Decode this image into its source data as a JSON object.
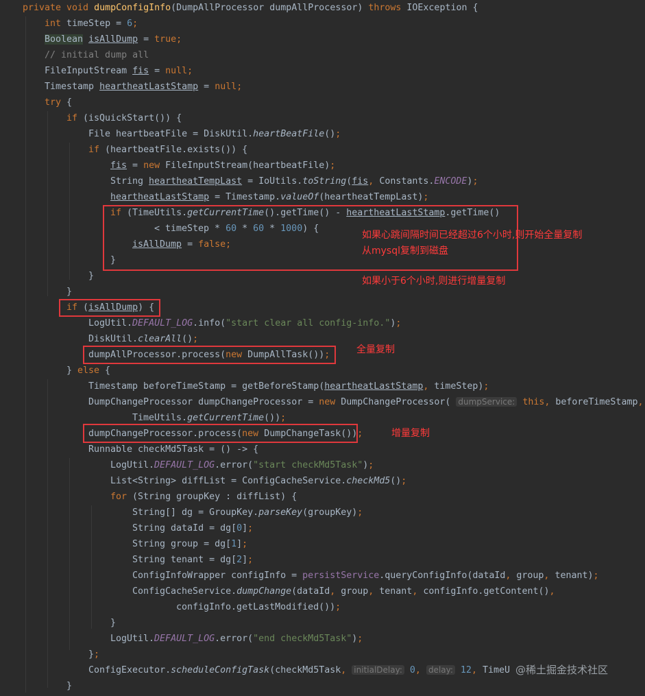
{
  "code_lines": [
    [
      {
        "c": "kw",
        "t": "private void "
      },
      {
        "c": "fn",
        "t": "dumpConfigInfo"
      },
      {
        "c": "",
        "t": "(DumpAllProcessor dumpAllProcessor) "
      },
      {
        "c": "kw",
        "t": "throws "
      },
      {
        "c": "",
        "t": "IOException {"
      }
    ],
    [
      {
        "c": "kw",
        "t": "int "
      },
      {
        "c": "",
        "t": "timeStep = "
      },
      {
        "c": "num",
        "t": "6"
      },
      {
        "c": "kw",
        "t": ";"
      }
    ],
    [
      {
        "c": "hlword",
        "t": "Boolean"
      },
      {
        "c": "",
        "t": " "
      },
      {
        "c": "ul",
        "t": "isAllDump"
      },
      {
        "c": "",
        "t": " = "
      },
      {
        "c": "kw",
        "t": "true;"
      }
    ],
    [
      {
        "c": "cmt",
        "t": "// initial dump all"
      }
    ],
    [
      {
        "c": "",
        "t": "FileInputStream "
      },
      {
        "c": "ul",
        "t": "fis"
      },
      {
        "c": "",
        "t": " = "
      },
      {
        "c": "kw",
        "t": "null;"
      }
    ],
    [
      {
        "c": "",
        "t": "Timestamp "
      },
      {
        "c": "ul",
        "t": "heartheatLastStamp"
      },
      {
        "c": "",
        "t": " = "
      },
      {
        "c": "kw",
        "t": "null;"
      }
    ],
    [
      {
        "c": "kw",
        "t": "try "
      },
      {
        "c": "",
        "t": "{"
      }
    ],
    [
      {
        "c": "kw",
        "t": "if "
      },
      {
        "c": "",
        "t": "(isQuickStart()) {"
      }
    ],
    [
      {
        "c": "",
        "t": "File heartbeatFile = DiskUtil."
      },
      {
        "c": "it",
        "t": "heartBeatFile"
      },
      {
        "c": "",
        "t": "()"
      },
      {
        "c": "kw",
        "t": ";"
      }
    ],
    [
      {
        "c": "kw",
        "t": "if "
      },
      {
        "c": "",
        "t": "(heartbeatFile.exists()) {"
      }
    ],
    [
      {
        "c": "ul",
        "t": "fis"
      },
      {
        "c": "",
        "t": " = "
      },
      {
        "c": "kw",
        "t": "new "
      },
      {
        "c": "",
        "t": "FileInputStream(heartbeatFile)"
      },
      {
        "c": "kw",
        "t": ";"
      }
    ],
    [
      {
        "c": "",
        "t": "String "
      },
      {
        "c": "ul",
        "t": "heartheatTempLast"
      },
      {
        "c": "",
        "t": " = IoUtils."
      },
      {
        "c": "it",
        "t": "toString"
      },
      {
        "c": "",
        "t": "("
      },
      {
        "c": "ul",
        "t": "fis"
      },
      {
        "c": "kw",
        "t": ", "
      },
      {
        "c": "",
        "t": "Constants."
      },
      {
        "c": "fld",
        "t": "ENCODE"
      },
      {
        "c": "",
        "t": ")"
      },
      {
        "c": "kw",
        "t": ";"
      }
    ],
    [
      {
        "c": "ul",
        "t": "heartheatLastStamp"
      },
      {
        "c": "",
        "t": " = Timestamp."
      },
      {
        "c": "it",
        "t": "valueOf"
      },
      {
        "c": "",
        "t": "(heartheatTempLast)"
      },
      {
        "c": "kw",
        "t": ";"
      }
    ],
    [
      {
        "c": "kw",
        "t": "if "
      },
      {
        "c": "",
        "t": "(TimeUtils."
      },
      {
        "c": "it",
        "t": "getCurrentTime"
      },
      {
        "c": "",
        "t": "().getTime() - "
      },
      {
        "c": "ul",
        "t": "heartheatLastStamp"
      },
      {
        "c": "",
        "t": ".getTime()"
      }
    ],
    [
      {
        "c": "",
        "t": "< timeStep * "
      },
      {
        "c": "num",
        "t": "60"
      },
      {
        "c": "",
        "t": " * "
      },
      {
        "c": "num",
        "t": "60"
      },
      {
        "c": "",
        "t": " * "
      },
      {
        "c": "num",
        "t": "1000"
      },
      {
        "c": "",
        "t": ") {"
      }
    ],
    [
      {
        "c": "ul",
        "t": "isAllDump"
      },
      {
        "c": "",
        "t": " = "
      },
      {
        "c": "kw",
        "t": "false;"
      }
    ],
    [
      {
        "c": "",
        "t": "}"
      }
    ],
    [
      {
        "c": "",
        "t": "}"
      }
    ],
    [
      {
        "c": "",
        "t": "}"
      }
    ],
    [
      {
        "c": "kw",
        "t": "if "
      },
      {
        "c": "",
        "t": "("
      },
      {
        "c": "ul",
        "t": "isAllDump"
      },
      {
        "c": "",
        "t": ") {"
      }
    ],
    [
      {
        "c": "",
        "t": "LogUtil."
      },
      {
        "c": "fld",
        "t": "DEFAULT_LOG"
      },
      {
        "c": "",
        "t": ".info("
      },
      {
        "c": "str",
        "t": "\"start clear all config-info.\""
      },
      {
        "c": "",
        "t": ")"
      },
      {
        "c": "kw",
        "t": ";"
      }
    ],
    [
      {
        "c": "",
        "t": "DiskUtil."
      },
      {
        "c": "it",
        "t": "clearAll"
      },
      {
        "c": "",
        "t": "()"
      },
      {
        "c": "kw",
        "t": ";"
      }
    ],
    [
      {
        "c": "",
        "t": "dumpAllProcessor.process("
      },
      {
        "c": "kw",
        "t": "new "
      },
      {
        "c": "",
        "t": "DumpAllTask())"
      },
      {
        "c": "kw",
        "t": ";"
      }
    ],
    [
      {
        "c": "",
        "t": "} "
      },
      {
        "c": "kw",
        "t": "else "
      },
      {
        "c": "",
        "t": "{"
      }
    ],
    [
      {
        "c": "",
        "t": "Timestamp beforeTimeStamp = getBeforeStamp("
      },
      {
        "c": "ul",
        "t": "heartheatLastStamp"
      },
      {
        "c": "kw",
        "t": ", "
      },
      {
        "c": "",
        "t": "timeStep)"
      },
      {
        "c": "kw",
        "t": ";"
      }
    ],
    [
      {
        "c": "",
        "t": "DumpChangeProcessor dumpChangeProcessor = "
      },
      {
        "c": "kw",
        "t": "new "
      },
      {
        "c": "",
        "t": "DumpChangeProcessor( "
      },
      {
        "c": "hint",
        "t": "dumpService:"
      },
      {
        "c": "",
        "t": " "
      },
      {
        "c": "kw",
        "t": "this, "
      },
      {
        "c": "",
        "t": "beforeTimeStamp"
      },
      {
        "c": "kw",
        "t": ","
      }
    ],
    [
      {
        "c": "",
        "t": "TimeUtils."
      },
      {
        "c": "it",
        "t": "getCurrentTime"
      },
      {
        "c": "",
        "t": "())"
      },
      {
        "c": "kw",
        "t": ";"
      }
    ],
    [
      {
        "c": "",
        "t": "dumpChangeProcessor.process("
      },
      {
        "c": "kw",
        "t": "new "
      },
      {
        "c": "",
        "t": "DumpChangeTask())"
      },
      {
        "c": "kw",
        "t": ";"
      }
    ],
    [
      {
        "c": "",
        "t": "Runnable checkMd5Task = () -> {"
      }
    ],
    [
      {
        "c": "",
        "t": "LogUtil."
      },
      {
        "c": "fld",
        "t": "DEFAULT_LOG"
      },
      {
        "c": "",
        "t": ".error("
      },
      {
        "c": "str",
        "t": "\"start checkMd5Task\""
      },
      {
        "c": "",
        "t": ")"
      },
      {
        "c": "kw",
        "t": ";"
      }
    ],
    [
      {
        "c": "",
        "t": "List<String> diffList = ConfigCacheService."
      },
      {
        "c": "it",
        "t": "checkMd5"
      },
      {
        "c": "",
        "t": "()"
      },
      {
        "c": "kw",
        "t": ";"
      }
    ],
    [
      {
        "c": "kw",
        "t": "for "
      },
      {
        "c": "",
        "t": "(String groupKey : diffList) {"
      }
    ],
    [
      {
        "c": "",
        "t": "String[] dg = GroupKey."
      },
      {
        "c": "it",
        "t": "parseKey"
      },
      {
        "c": "",
        "t": "(groupKey)"
      },
      {
        "c": "kw",
        "t": ";"
      }
    ],
    [
      {
        "c": "",
        "t": "String dataId = dg["
      },
      {
        "c": "num",
        "t": "0"
      },
      {
        "c": "",
        "t": "]"
      },
      {
        "c": "kw",
        "t": ";"
      }
    ],
    [
      {
        "c": "",
        "t": "String group = dg["
      },
      {
        "c": "num",
        "t": "1"
      },
      {
        "c": "",
        "t": "]"
      },
      {
        "c": "kw",
        "t": ";"
      }
    ],
    [
      {
        "c": "",
        "t": "String tenant = dg["
      },
      {
        "c": "num",
        "t": "2"
      },
      {
        "c": "",
        "t": "]"
      },
      {
        "c": "kw",
        "t": ";"
      }
    ],
    [
      {
        "c": "",
        "t": "ConfigInfoWrapper configInfo = "
      },
      {
        "c": "mem",
        "t": "persistService"
      },
      {
        "c": "",
        "t": ".queryConfigInfo(dataId"
      },
      {
        "c": "kw",
        "t": ", "
      },
      {
        "c": "",
        "t": "group"
      },
      {
        "c": "kw",
        "t": ", "
      },
      {
        "c": "",
        "t": "tenant)"
      },
      {
        "c": "kw",
        "t": ";"
      }
    ],
    [
      {
        "c": "",
        "t": "ConfigCacheService."
      },
      {
        "c": "it",
        "t": "dumpChange"
      },
      {
        "c": "",
        "t": "(dataId"
      },
      {
        "c": "kw",
        "t": ", "
      },
      {
        "c": "",
        "t": "group"
      },
      {
        "c": "kw",
        "t": ", "
      },
      {
        "c": "",
        "t": "tenant"
      },
      {
        "c": "kw",
        "t": ", "
      },
      {
        "c": "",
        "t": "configInfo.getContent()"
      },
      {
        "c": "kw",
        "t": ","
      }
    ],
    [
      {
        "c": "",
        "t": "configInfo.getLastModified())"
      },
      {
        "c": "kw",
        "t": ";"
      }
    ],
    [
      {
        "c": "",
        "t": "}"
      }
    ],
    [
      {
        "c": "",
        "t": "LogUtil."
      },
      {
        "c": "fld",
        "t": "DEFAULT_LOG"
      },
      {
        "c": "",
        "t": ".error("
      },
      {
        "c": "str",
        "t": "\"end checkMd5Task\""
      },
      {
        "c": "",
        "t": ")"
      },
      {
        "c": "kw",
        "t": ";"
      }
    ],
    [
      {
        "c": "",
        "t": "}"
      },
      {
        "c": "kw",
        "t": ";"
      }
    ],
    [
      {
        "c": "",
        "t": "ConfigExecutor."
      },
      {
        "c": "it",
        "t": "scheduleConfigTask"
      },
      {
        "c": "",
        "t": "(checkMd5Task"
      },
      {
        "c": "kw",
        "t": ", "
      },
      {
        "c": "hint",
        "t": "initialDelay:"
      },
      {
        "c": "",
        "t": " "
      },
      {
        "c": "num",
        "t": "0"
      },
      {
        "c": "kw",
        "t": ", "
      },
      {
        "c": "hint",
        "t": "delay:"
      },
      {
        "c": "",
        "t": " "
      },
      {
        "c": "num",
        "t": "12"
      },
      {
        "c": "kw",
        "t": ", "
      },
      {
        "c": "",
        "t": "TimeU"
      }
    ],
    [
      {
        "c": "",
        "t": "}"
      }
    ]
  ],
  "annotations": {
    "note_time_check_line1": "如果心跳间隔时间已经超过6个小时,则开始全量复制",
    "note_time_check_line2": "从mysql复制到磁盘",
    "note_incremental_condition": "如果小于6个小时,则进行增量复制",
    "note_full_copy": "全量复制",
    "note_incremental_copy": "增量复制"
  },
  "watermark": "@稀土掘金技术社区",
  "colors": {
    "background": "#2b2b2b",
    "keyword": "#cc7832",
    "number": "#6897bb",
    "string": "#6a8759",
    "comment": "#808080",
    "method": "#ffc66d",
    "static_field": "#9876aa",
    "text": "#a9b7c6",
    "annotation_red": "#ff3b3b"
  }
}
